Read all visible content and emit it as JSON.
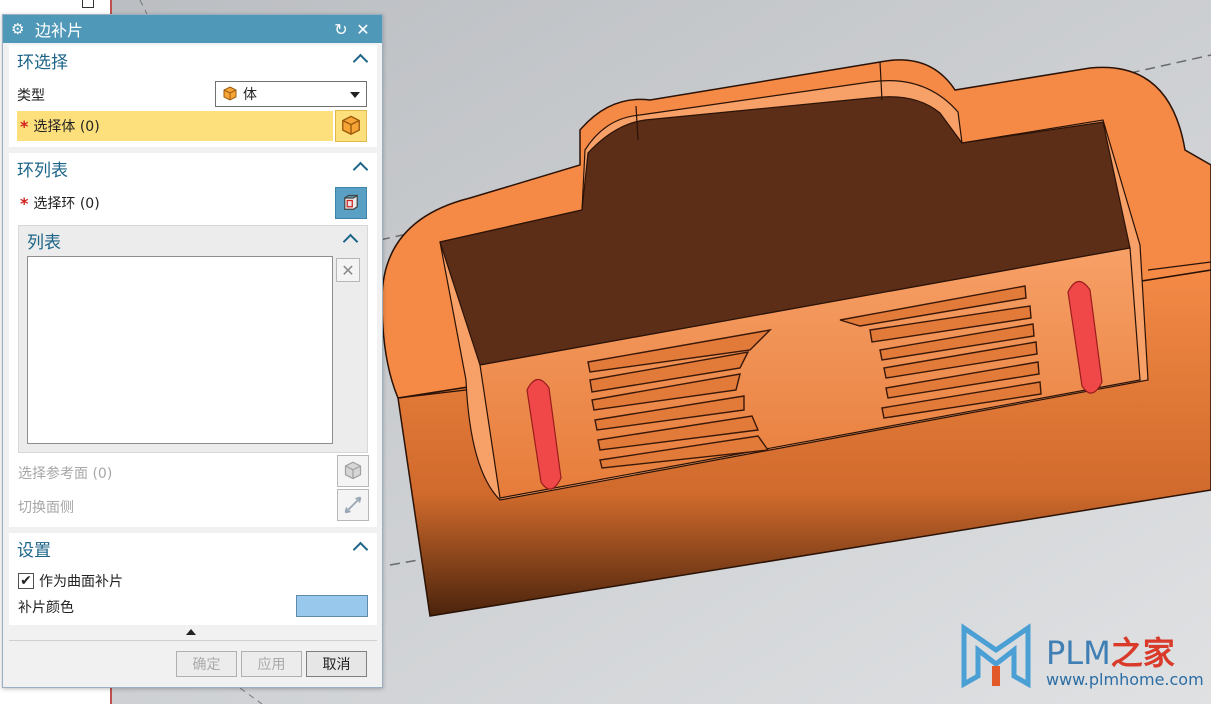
{
  "dialog": {
    "title": "边补片",
    "sections": {
      "loop_select": {
        "title": "环选择",
        "type_label": "类型",
        "type_value": "体",
        "select_body": "选择体 (0)"
      },
      "loop_list": {
        "title": "环列表",
        "select_loop": "选择环 (0)",
        "list_title": "列表",
        "ref_face": "选择参考面 (0)",
        "switch_side": "切换面侧"
      },
      "settings": {
        "title": "设置",
        "as_surface_patch": "作为曲面补片",
        "as_surface_patch_checked": true,
        "patch_color_label": "补片颜色",
        "patch_color": "#98c8ec"
      }
    },
    "buttons": {
      "ok": "确定",
      "apply": "应用",
      "cancel": "取消"
    }
  },
  "watermark": {
    "brand": "PLM",
    "brand_cn": "之家",
    "url": "www.plmhome.com"
  },
  "colors": {
    "titlebar": "#4f98b8",
    "highlight": "#fde07c",
    "model_orange": "#f48a46",
    "model_cavity": "#5c2e18",
    "marker_red": "#f04848"
  }
}
